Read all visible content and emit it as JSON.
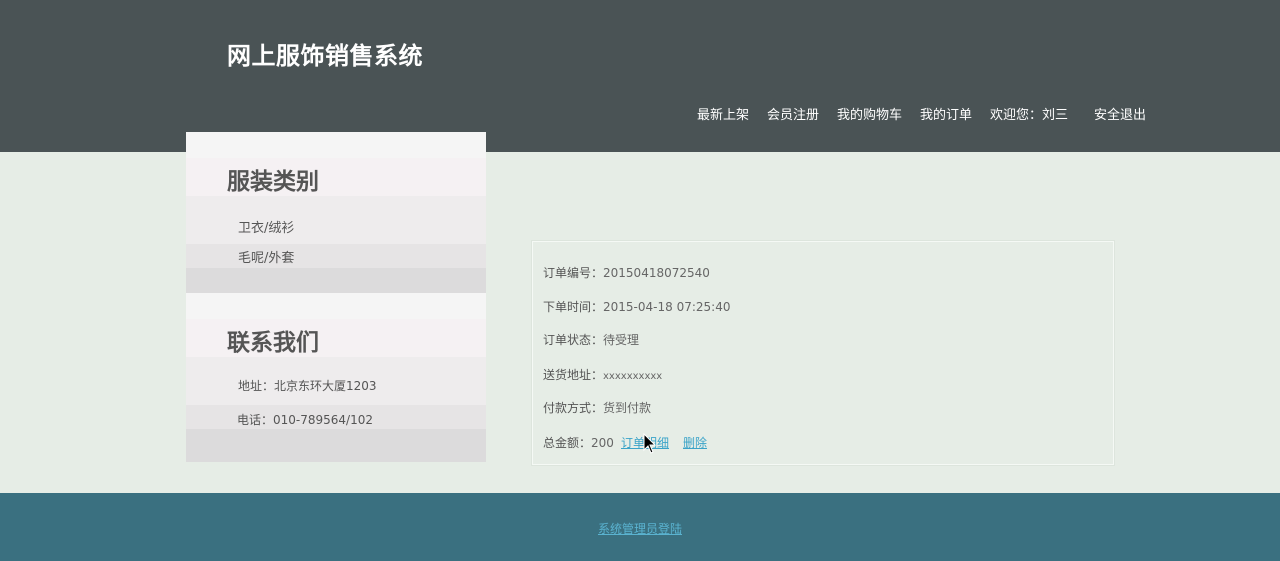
{
  "header": {
    "site_title": "网上服饰销售系统",
    "nav": {
      "new_arrivals": "最新上架",
      "register": "会员注册",
      "cart": "我的购物车",
      "orders": "我的订单",
      "welcome": "欢迎您：刘三",
      "logout": "安全退出"
    }
  },
  "sidebar": {
    "category": {
      "title": "服装类别",
      "items": [
        "卫衣/绒衫",
        "毛呢/外套"
      ]
    },
    "contact": {
      "title": "联系我们",
      "address": "地址：北京东环大厦1203",
      "phone": "电话：010-789564/102"
    }
  },
  "order": {
    "number_label": "订单编号：",
    "number": "20150418072540",
    "time_label": "下单时间：",
    "time": "2015-04-18 07:25:40",
    "status_label": "订单状态：",
    "status": "待受理",
    "address_label": "送货地址：",
    "address": "xxxxxxxxxx",
    "payment_label": "付款方式：",
    "payment": "货到付款",
    "total_label": "总金额：",
    "total": "200",
    "detail_link": "订单明细",
    "delete_link": "删除"
  },
  "footer": {
    "admin_login": "系统管理员登陆"
  },
  "colors": {
    "header_bg": "#4a5355",
    "page_bg": "#e6ede6",
    "footer_bg": "#3a7080",
    "link": "#3aa3c8"
  }
}
